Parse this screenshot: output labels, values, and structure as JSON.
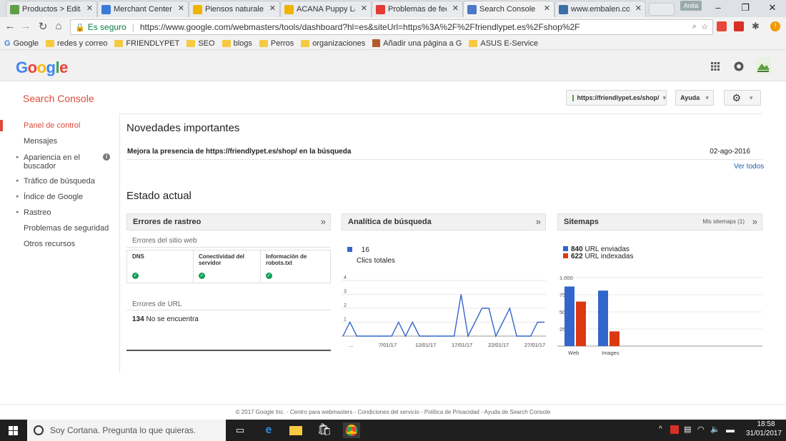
{
  "browser": {
    "tabs": [
      {
        "title": "Productos > Editar",
        "color": "#5f9f43",
        "active": false
      },
      {
        "title": "Merchant Center",
        "color": "#3b7bd8",
        "active": false
      },
      {
        "title": "Piensos naturales p",
        "color": "#f0b400",
        "active": false
      },
      {
        "title": "ACANA Puppy Lar",
        "color": "#f0b400",
        "active": false
      },
      {
        "title": "Problemas de feed",
        "color": "#e53935",
        "active": false
      },
      {
        "title": "Search Console - F",
        "color": "#4a79c9",
        "active": true
      },
      {
        "title": "www.embalen.com",
        "color": "#3a6ea5",
        "active": false
      }
    ],
    "profile_name": "Anita",
    "window_controls": [
      "–",
      "❐",
      "✕"
    ],
    "secure_label": "Es seguro",
    "url": "https://www.google.com/webmasters/tools/dashboard?hl=es&siteUrl=https%3A%2F%2Ffriendlypet.es%2Fshop%2F",
    "bookmarks": [
      {
        "label": "Google",
        "type": "google"
      },
      {
        "label": "redes y correo",
        "type": "folder"
      },
      {
        "label": "FRIENDLYPET",
        "type": "folder"
      },
      {
        "label": "SEO",
        "type": "folder"
      },
      {
        "label": "blogs",
        "type": "folder"
      },
      {
        "label": "Perros",
        "type": "folder"
      },
      {
        "label": "organizaciones",
        "type": "folder"
      },
      {
        "label": "Añadir una página a G",
        "type": "page"
      },
      {
        "label": "ASUS E-Service",
        "type": "folder"
      }
    ]
  },
  "google": {
    "logo_letters": [
      "G",
      "o",
      "o",
      "g",
      "l",
      "e"
    ],
    "logo_colors": [
      "#4285f4",
      "#ea4335",
      "#fbbc05",
      "#4285f4",
      "#34a853",
      "#ea4335"
    ]
  },
  "sc": {
    "title": "Search Console",
    "site_selector": "https://friendlypet.es/shop/",
    "help_label": "Ayuda"
  },
  "nav": [
    {
      "label": "Panel de control",
      "active": true,
      "expandable": false
    },
    {
      "label": "Mensajes",
      "active": false,
      "expandable": false
    },
    {
      "label": "Apariencia en el buscador",
      "active": false,
      "expandable": true,
      "info": true
    },
    {
      "label": "Tráfico de búsqueda",
      "active": false,
      "expandable": true
    },
    {
      "label": "Índice de Google",
      "active": false,
      "expandable": true
    },
    {
      "label": "Rastreo",
      "active": false,
      "expandable": true
    },
    {
      "label": "Problemas de seguridad",
      "active": false,
      "expandable": false
    },
    {
      "label": "Otros recursos",
      "active": false,
      "expandable": false
    }
  ],
  "news": {
    "heading": "Novedades importantes",
    "item_text": "Mejora la presencia de https://friendlypet.es/shop/ en la búsqueda",
    "item_date": "02-ago-2016",
    "view_all": "Ver todos"
  },
  "status": {
    "heading": "Estado actual",
    "crawl": {
      "title": "Errores de rastreo",
      "site_errors_label": "Errores del sitio web",
      "columns": [
        "DNS",
        "Conectividad del servidor",
        "Información de robots.txt"
      ],
      "url_errors_label": "Errores de URL",
      "url_error_count": "134",
      "url_error_text": "No se encuentra"
    },
    "analytics": {
      "title": "Analítica de búsqueda",
      "clicks_value": "16",
      "clicks_label": "Clics totales"
    },
    "sitemaps": {
      "title": "Sitemaps",
      "link": "Mis sitemaps (1)",
      "submitted_count": "840",
      "submitted_label": "URL enviadas",
      "indexed_count": "622",
      "indexed_label": "URL indexadas"
    }
  },
  "chart_data": [
    {
      "type": "line",
      "x_tick_labels": [
        "...",
        "7/01/17",
        "12/01/17",
        "17/01/17",
        "22/01/17",
        "27/01/17"
      ],
      "y_tick_labels": [
        "1",
        "2",
        "3",
        "4"
      ],
      "ylim": [
        0,
        4
      ],
      "color": "#3366cc",
      "series": [
        {
          "values": [
            0,
            1,
            0,
            0,
            0,
            0,
            0,
            0,
            1,
            0,
            1,
            0,
            0,
            0,
            0,
            0,
            0,
            3,
            0,
            1,
            2,
            2,
            0,
            1,
            2,
            0,
            0,
            0,
            1,
            1
          ]
        }
      ]
    },
    {
      "type": "bar",
      "categories": [
        "Web",
        "Images"
      ],
      "y_tick_labels": [
        "250",
        "500",
        "750",
        "1.000"
      ],
      "ylim": [
        0,
        1000
      ],
      "series": [
        {
          "name": "URL enviadas",
          "color": "#3366cc",
          "values": [
            870,
            810
          ]
        },
        {
          "name": "URL indexadas",
          "color": "#dc3912",
          "values": [
            650,
            215
          ]
        }
      ]
    }
  ],
  "footer": {
    "text": "© 2017 Google Inc. - Centro para webmasters - Condiciones del servicio - Política de Privacidad - Ayuda de Search Console"
  },
  "taskbar": {
    "cortana_placeholder": "Soy Cortana. Pregunta lo que quieras.",
    "time": "18:58",
    "date": "31/01/2017"
  }
}
